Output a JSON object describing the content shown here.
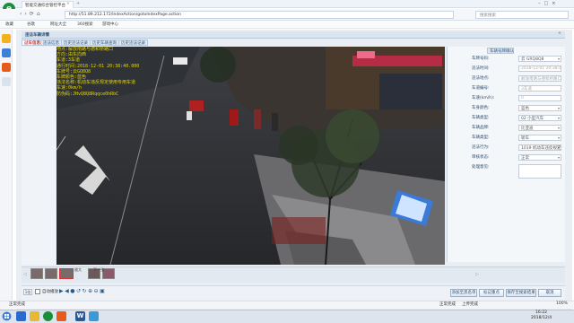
{
  "browser": {
    "tab_title": "智能交通综合管控平台",
    "url": "http://51.89.212.172/IndexAction/gotoIndexPage.action",
    "search_placeholder": "搜索搜索",
    "favorites": [
      "收藏",
      "谷歌",
      "网址大全",
      "360搜索",
      "游戏中心"
    ],
    "nav_icons": [
      "back-icon",
      "forward-icon",
      "refresh-icon",
      "home-icon"
    ]
  },
  "dialog": {
    "title": "违法车辆详情",
    "tabs": [
      "过车信息",
      "违法信息",
      "历史违法记录",
      "历史车辆查询",
      "历史违法记录"
    ],
    "active_tab_index": 0
  },
  "overlay": {
    "lines": [
      "地点:解放南路与德和桥路口",
      "方向:由东向西",
      "车道:3车道",
      "通行时间:2018-12-01 20:38:40.000",
      "车牌号:云GQ8Q8",
      "车牌颜色:蓝色",
      "违法名称:机动车违反规定使用专用车道",
      "车速:0km/h",
      "防伪码:JHvQ8Q8Rqqce0hRbC"
    ]
  },
  "right_panel": {
    "header": "车辆号牌确认",
    "fields": [
      {
        "label": "车牌号码:",
        "value": "云  GRQ8Q8",
        "type": "select",
        "readonly": false
      },
      {
        "label": "违法时间:",
        "value": "2018-12-01 20:38:40.000",
        "type": "text",
        "readonly": true
      },
      {
        "label": "违法地点:",
        "value": "解放南路与德和桥路口",
        "type": "text",
        "readonly": true
      },
      {
        "label": "车道编号:",
        "value": "3车道",
        "type": "text",
        "readonly": true
      },
      {
        "label": "车速(km/h):",
        "value": "0",
        "type": "text",
        "readonly": true
      },
      {
        "label": "车身颜色:",
        "value": "蓝色",
        "type": "select",
        "readonly": false
      },
      {
        "label": "车辆类型:",
        "value": "02 小型汽车",
        "type": "select",
        "readonly": false
      },
      {
        "label": "车辆品牌:",
        "value": "比亚迪",
        "type": "select",
        "readonly": false
      },
      {
        "label": "车辆类型:",
        "value": "轿车",
        "type": "select",
        "readonly": false
      },
      {
        "label": "违法行为:",
        "value": "1019 机动车违反规定使用专用车道",
        "type": "select",
        "readonly": false
      },
      {
        "label": "审核状态:",
        "value": "正常",
        "type": "select",
        "readonly": false
      },
      {
        "label": "处理意见:",
        "value": "",
        "type": "textarea",
        "readonly": false
      }
    ]
  },
  "thumbnails": {
    "count": 5,
    "selected_index": 2,
    "fullscreen_label": "放大",
    "next_label": "下一张"
  },
  "controls": {
    "zoom_value": "1倍",
    "auto_label": "自动播放",
    "icons": [
      "play-icon",
      "prev-icon",
      "stop-icon",
      "rotate-left-icon",
      "rotate-right-icon",
      "zoom-in-icon",
      "zoom-out-icon",
      "fit-icon"
    ],
    "buttons": [
      "添加至黑名单",
      "标记重点",
      "保存至搜索结果",
      "取消"
    ]
  },
  "statusbar": {
    "left": "正常完成",
    "right": [
      "正常完成",
      "上传完成",
      "100%"
    ]
  },
  "taskbar": {
    "time": "16:22",
    "date": "2018/12/4"
  },
  "colors": {
    "overlay_text": "#e6d600",
    "accent": "#2a5a8a",
    "active_tab": "#cc3333"
  }
}
